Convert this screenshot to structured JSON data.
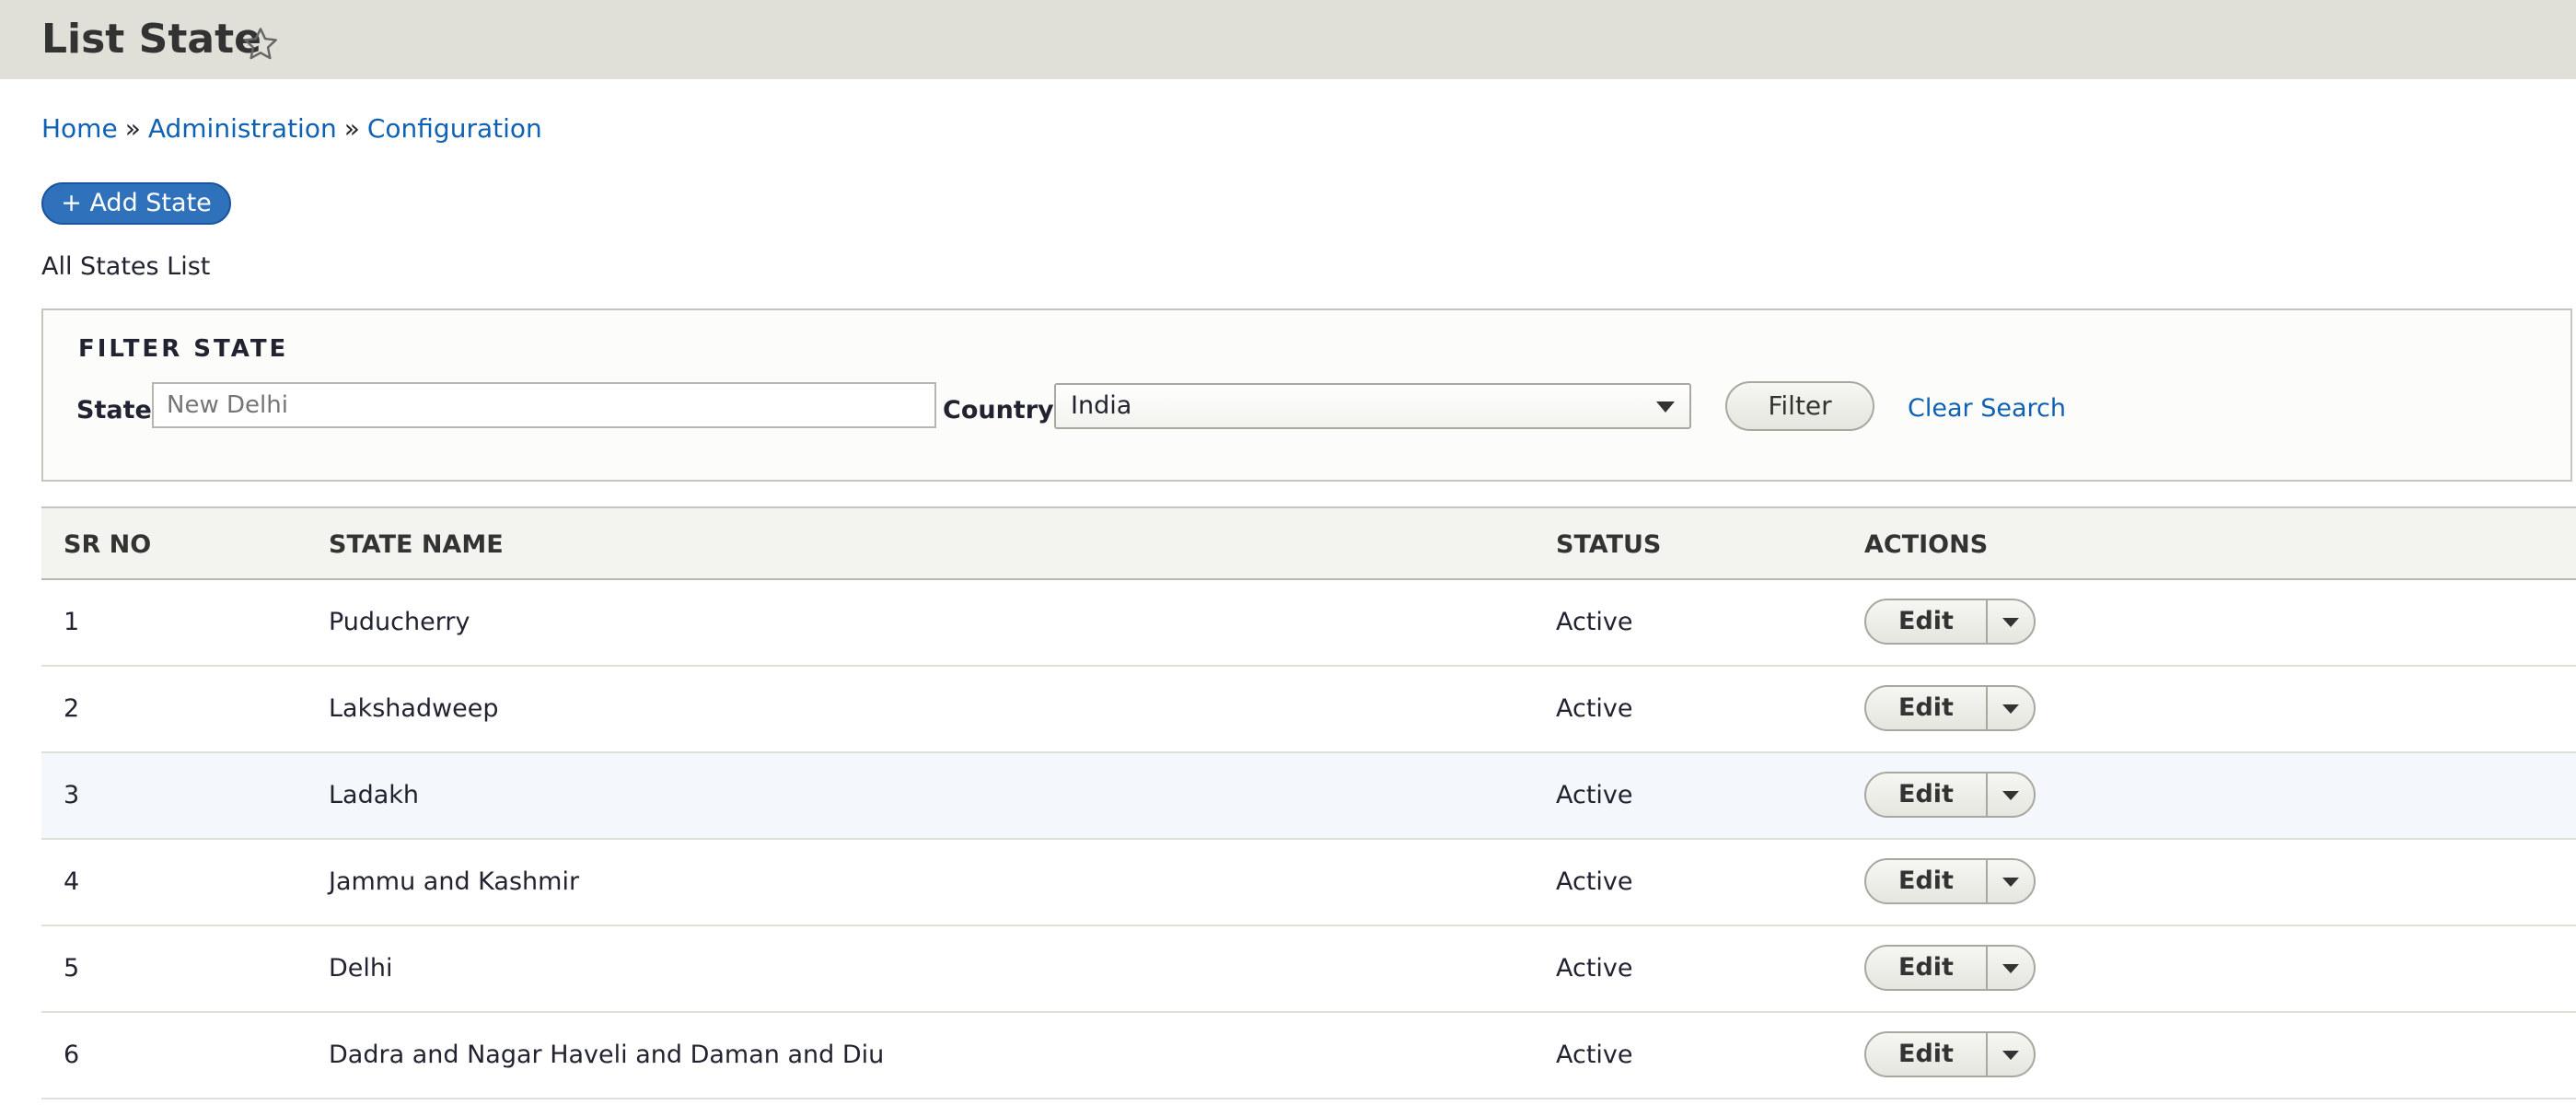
{
  "header": {
    "title": "List State",
    "star_icon": "star-outline-icon"
  },
  "breadcrumb": {
    "items": [
      "Home",
      "Administration",
      "Configuration"
    ],
    "separator": "»"
  },
  "toolbar": {
    "add_label": "+ Add State"
  },
  "list_caption": "All States List",
  "filter": {
    "legend": "FILTER STATE",
    "state_label": "State:",
    "state_placeholder": "New Delhi",
    "state_value": "",
    "country_label": "Country:",
    "country_value": "India",
    "filter_label": "Filter",
    "clear_label": "Clear Search"
  },
  "table": {
    "columns": [
      "SR NO",
      "STATE NAME",
      "STATUS",
      "ACTIONS"
    ],
    "rows": [
      {
        "sr": "1",
        "name": "Puducherry",
        "status": "Active",
        "action": "Edit"
      },
      {
        "sr": "2",
        "name": "Lakshadweep",
        "status": "Active",
        "action": "Edit"
      },
      {
        "sr": "3",
        "name": "Ladakh",
        "status": "Active",
        "action": "Edit"
      },
      {
        "sr": "4",
        "name": "Jammu and Kashmir",
        "status": "Active",
        "action": "Edit"
      },
      {
        "sr": "5",
        "name": "Delhi",
        "status": "Active",
        "action": "Edit"
      },
      {
        "sr": "6",
        "name": "Dadra and Nagar Haveli and Daman and Diu",
        "status": "Active",
        "action": "Edit"
      }
    ]
  },
  "colors": {
    "header_bg": "#e0e0d8",
    "link": "#0f61b3",
    "primary_button": "#2f72bb",
    "row_highlight": "#f4f8fd"
  }
}
